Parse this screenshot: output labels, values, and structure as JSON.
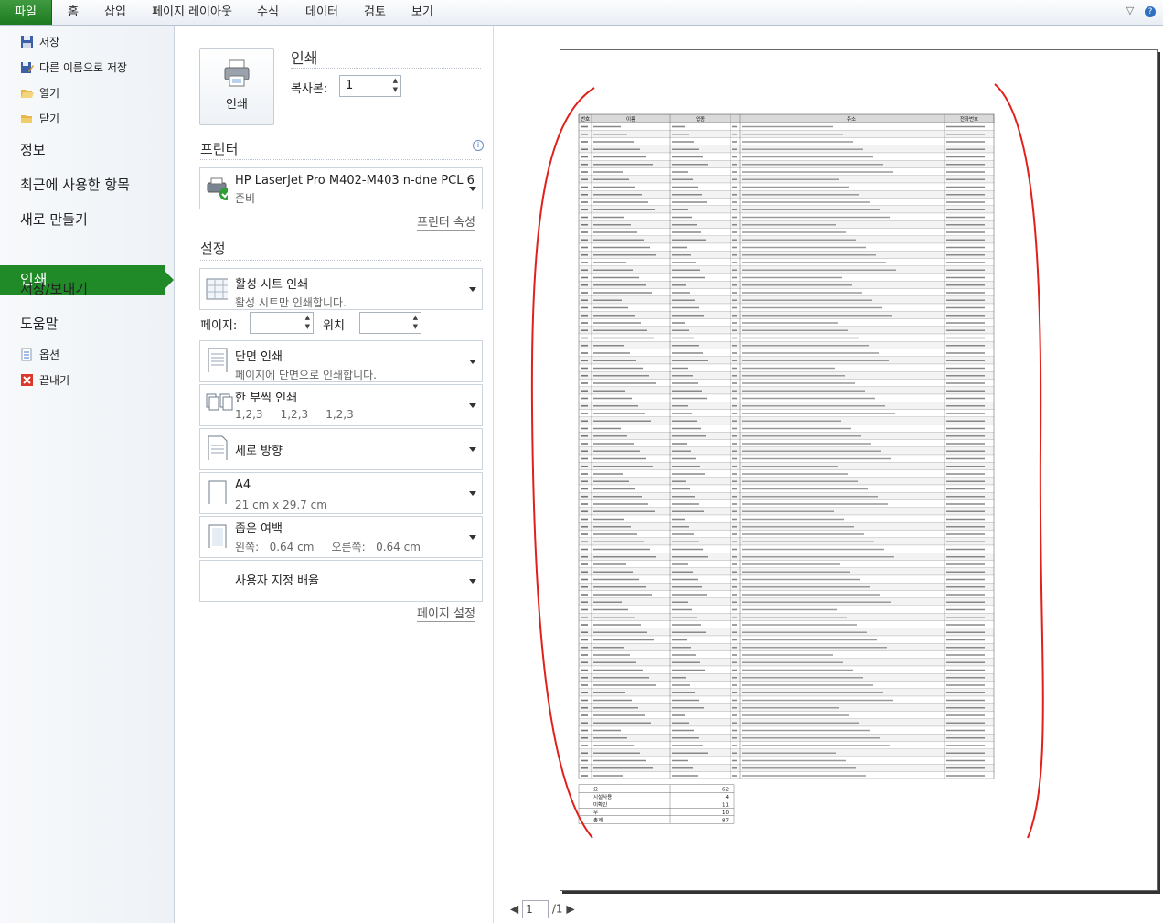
{
  "ribbon": {
    "tabs": [
      "파일",
      "홈",
      "삽입",
      "페이지 레이아웃",
      "수식",
      "데이터",
      "검토",
      "보기"
    ]
  },
  "nav": {
    "save": "저장",
    "save_as": "다른 이름으로 저장",
    "open": "열기",
    "close": "닫기",
    "info": "정보",
    "recent": "최근에 사용한 항목",
    "new": "새로 만들기",
    "print": "인쇄",
    "save_send": "저장/보내기",
    "help": "도움말",
    "options": "옵션",
    "exit": "끝내기"
  },
  "print_panel": {
    "print_button": "인쇄",
    "heading": "인쇄",
    "copies_label": "복사본:",
    "copies_value": "1",
    "printer_heading": "프린터",
    "printer_name": "HP LaserJet Pro M402-M403 n-dne PCL 6",
    "printer_status": "준비",
    "printer_properties": "프린터 속성",
    "settings_heading": "설정",
    "what": {
      "t1": "활성 시트 인쇄",
      "t2": "활성 시트만 인쇄합니다."
    },
    "pages_label": "페이지:",
    "to_label": "위치",
    "sided": {
      "t1": "단면 인쇄",
      "t2": "페이지에 단면으로 인쇄합니다."
    },
    "collate": {
      "t1": "한 부씩 인쇄",
      "t2": "1,2,3     1,2,3     1,2,3"
    },
    "orientation": {
      "t1": "세로 방향"
    },
    "paper": {
      "t1": "A4",
      "t2": "21 cm x 29.7 cm"
    },
    "margins": {
      "t1": "좁은 여백",
      "t2": "왼쪽:   0.64 cm     오른쪽:   0.64 cm"
    },
    "scaling": {
      "t1": "사용자 지정 배율"
    },
    "page_setup": "페이지 설정"
  },
  "preview": {
    "current_page": "1",
    "total_pages": "/1",
    "table_headers": [
      "번호",
      "이름",
      "업종",
      "",
      "주소",
      "전화번호"
    ],
    "row_count": 87,
    "summary": [
      {
        "label": "요",
        "value": "62"
      },
      {
        "label": "시설사용",
        "value": "4"
      },
      {
        "label": "미확인",
        "value": "11"
      },
      {
        "label": "무",
        "value": "10"
      },
      {
        "label": "총계",
        "value": "87"
      }
    ]
  },
  "colors": {
    "file_tab": "#1f8a27",
    "selection": "#1f8a27",
    "annotation": "#e0201a"
  }
}
